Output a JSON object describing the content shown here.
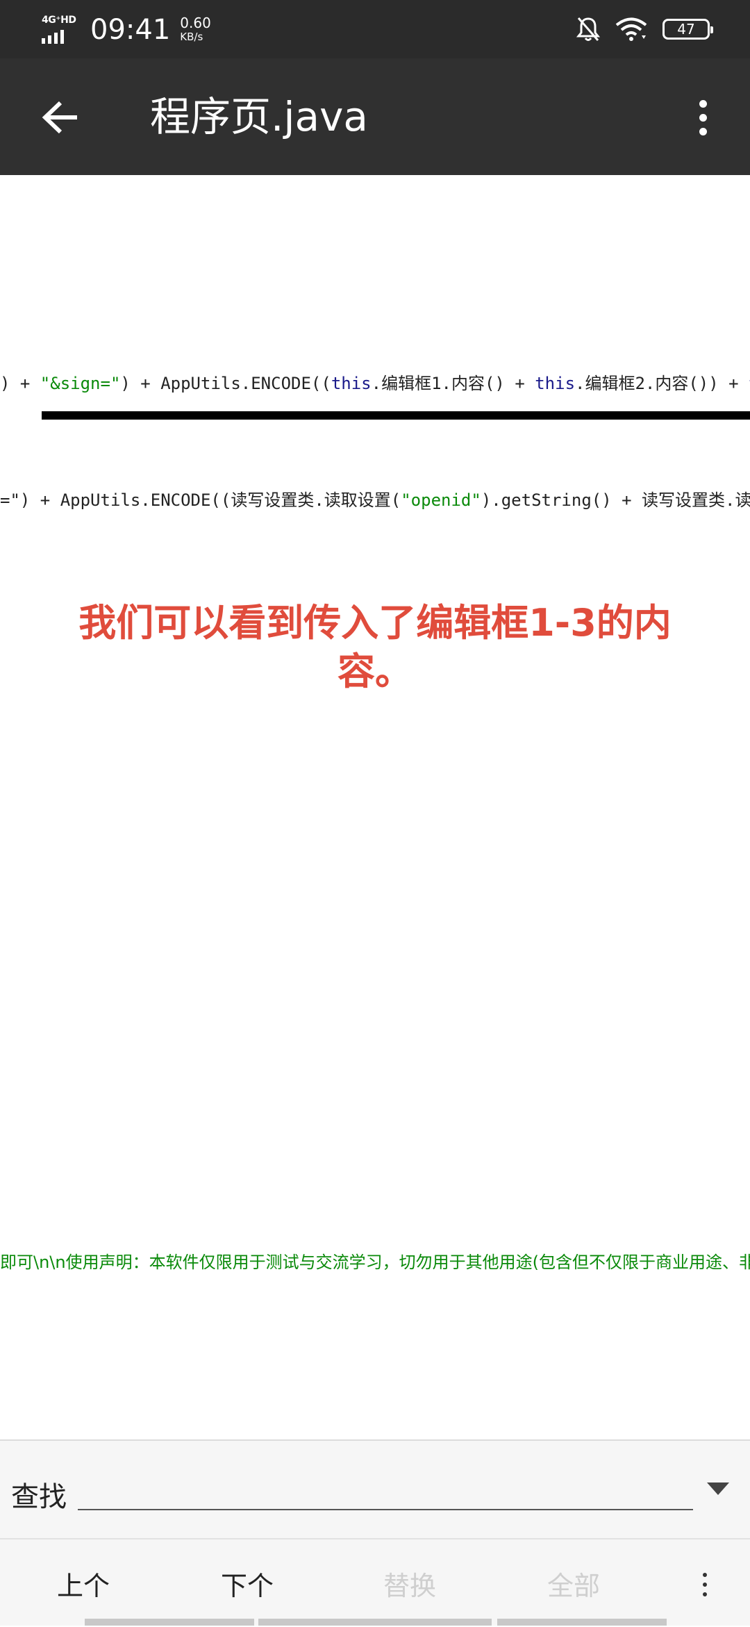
{
  "status_bar": {
    "network": "4G⁺HD",
    "time": "09:41",
    "speed_value": "0.60",
    "speed_unit": "KB/s",
    "battery": "47",
    "icons": [
      "signal-icon",
      "mute-bell-icon",
      "wifi-icon",
      "battery-icon"
    ]
  },
  "toolbar": {
    "title": "程序页.java",
    "icons": [
      "back-arrow-icon",
      "more-vert-icon"
    ]
  },
  "code": {
    "line1": {
      "p1": ") + ",
      "s1": "\"&sign=\"",
      "p2": ") + AppUtils.ENCODE((",
      "k1": "this",
      "p3": ".编辑框1.内容() + ",
      "k2": "this",
      "p4": ".编辑框2.内容()) + ",
      "k3": "th"
    },
    "line2": {
      "p1": "=\") + AppUtils.ENCODE((读写设置类.读取设置(",
      "s1": "\"openid\"",
      "p2": ").getString() + 读写设置类.读取"
    },
    "line3": "即可\\n\\n使用声明：本软件仅限用于测试与交流学习，切勿用于其他用途(包含但不仅限于商业用途、非"
  },
  "annotation": {
    "text": "我们可以看到传入了编辑框1-3的内容。",
    "color": "#e04c3c"
  },
  "find_bar": {
    "label": "查找",
    "input_value": "",
    "buttons": {
      "prev": "上个",
      "next": "下个",
      "replace": "替换",
      "all": "全部"
    }
  }
}
